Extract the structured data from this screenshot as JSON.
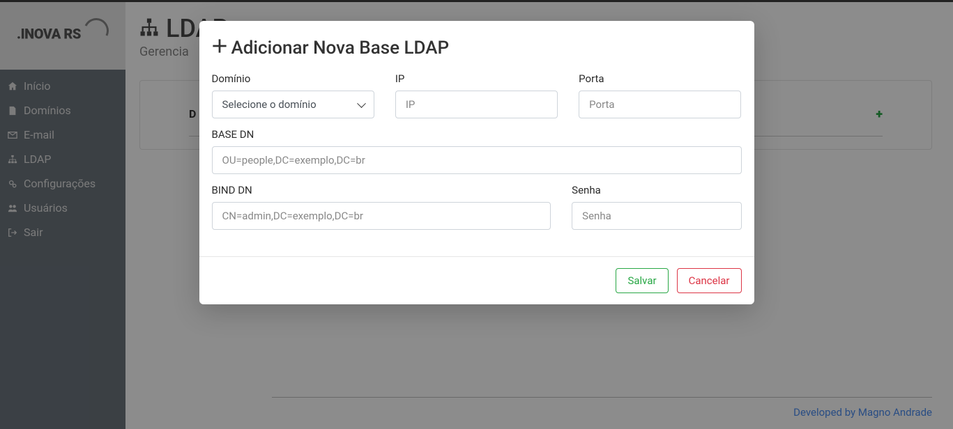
{
  "brand": ".INOVA RS",
  "sidebar": {
    "items": [
      {
        "label": "Início",
        "icon": "home-icon"
      },
      {
        "label": "Domínios",
        "icon": "document-icon"
      },
      {
        "label": "E-mail",
        "icon": "envelope-icon"
      },
      {
        "label": "LDAP",
        "icon": "sitemap-icon"
      },
      {
        "label": "Configurações",
        "icon": "gears-icon"
      },
      {
        "label": "Usuários",
        "icon": "users-icon"
      },
      {
        "label": "Sair",
        "icon": "signout-icon"
      }
    ]
  },
  "page": {
    "title": "LDAP",
    "subtitle": "Gerencia"
  },
  "table": {
    "headers": {
      "domain": "D"
    }
  },
  "modal": {
    "title": "Adicionar Nova Base LDAP",
    "fields": {
      "domain_label": "Domínio",
      "domain_selected": "Selecione o domínio",
      "ip_label": "IP",
      "ip_placeholder": "IP",
      "port_label": "Porta",
      "port_placeholder": "Porta",
      "basedn_label": "BASE DN",
      "basedn_placeholder": "OU=people,DC=exemplo,DC=br",
      "binddn_label": "BIND DN",
      "binddn_placeholder": "CN=admin,DC=exemplo,DC=br",
      "password_label": "Senha",
      "password_placeholder": "Senha"
    },
    "buttons": {
      "save": "Salvar",
      "cancel": "Cancelar"
    }
  },
  "footer": {
    "credit": "Developed by Magno Andrade"
  }
}
